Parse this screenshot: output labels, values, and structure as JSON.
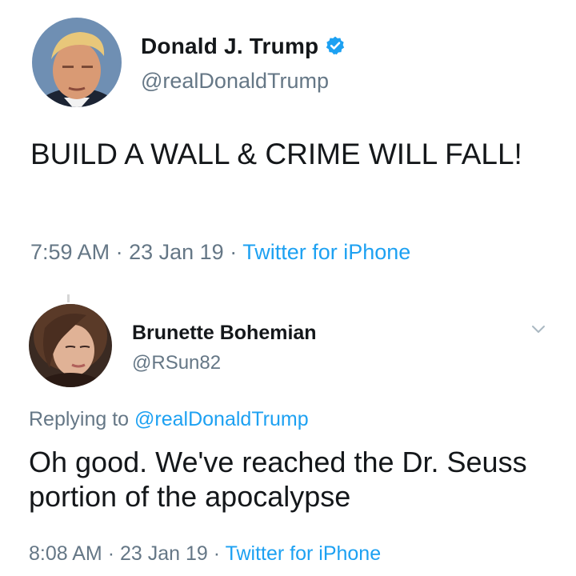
{
  "tweets": [
    {
      "display_name": "Donald J. Trump",
      "handle": "@realDonaldTrump",
      "verified": true,
      "text": "BUILD A WALL & CRIME WILL FALL!",
      "time": "7:59 AM",
      "date": "23 Jan 19",
      "source": "Twitter for iPhone",
      "separator": "·",
      "avatar_icon": "avatar-photo"
    },
    {
      "display_name": "Brunette Bohemian",
      "handle": "@RSun82",
      "reply_prefix": "Replying to",
      "reply_to": "@realDonaldTrump",
      "text": "Oh good. We've reached the Dr. Seuss portion of the apocalypse",
      "time": "8:08 AM",
      "date": "23 Jan 19",
      "source": "Twitter for iPhone",
      "separator": "·",
      "avatar_icon": "avatar-photo",
      "menu_icon": "chevron-down-icon"
    }
  ],
  "colors": {
    "text": "#14171a",
    "secondary": "#657786",
    "link": "#1da1f2",
    "verified": "#1da1f2"
  }
}
